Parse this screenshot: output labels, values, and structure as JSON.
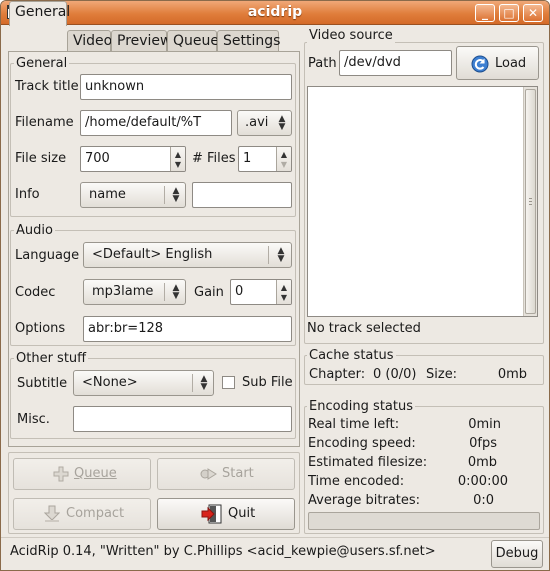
{
  "window": {
    "title": "acidrip",
    "controls": {
      "minimize": "_",
      "maximize": "□",
      "close": "✕"
    }
  },
  "tabs": [
    {
      "label": "General"
    },
    {
      "label": "Video"
    },
    {
      "label": "Preview"
    },
    {
      "label": "Queue"
    },
    {
      "label": "Settings"
    }
  ],
  "general": {
    "frame_label": "General",
    "track_title_label": "Track title",
    "track_title_value": "unknown",
    "filename_label": "Filename",
    "filename_value": "/home/default/%T",
    "extension_value": ".avi",
    "filesize_label": "File size",
    "filesize_value": "700",
    "files_label": "# Files",
    "files_value": "1",
    "info_label": "Info",
    "info_combo_value": "name",
    "info_entry_value": ""
  },
  "audio": {
    "frame_label": "Audio",
    "language_label": "Language",
    "language_value": "<Default> English",
    "codec_label": "Codec",
    "codec_value": "mp3lame",
    "gain_label": "Gain",
    "gain_value": "0",
    "options_label": "Options",
    "options_value": "abr:br=128"
  },
  "other": {
    "frame_label": "Other stuff",
    "subtitle_label": "Subtitle",
    "subtitle_value": "<None>",
    "subfile_label": "Sub File",
    "subfile_checked": false,
    "misc_label": "Misc.",
    "misc_value": ""
  },
  "actions": {
    "queue_label": "Queue",
    "start_label": "Start",
    "compact_label": "Compact",
    "quit_label": "Quit"
  },
  "video_source": {
    "frame_label": "Video source",
    "path_label": "Path",
    "path_value": "/dev/dvd",
    "load_label": "Load",
    "track_status": "No track selected"
  },
  "cache_status": {
    "frame_label": "Cache status",
    "chapter_label": "Chapter:",
    "chapter_value": "0 (0/0)",
    "size_label": "Size:",
    "size_value": "0mb"
  },
  "encoding_status": {
    "frame_label": "Encoding status",
    "rows": [
      {
        "label": "Real time left:",
        "value": "0min"
      },
      {
        "label": "Encoding speed:",
        "value": "0fps"
      },
      {
        "label": "Estimated filesize:",
        "value": "0mb"
      },
      {
        "label": "Time encoded:",
        "value": "0:00:00"
      },
      {
        "label": "Average bitrates:",
        "value": "0:0"
      }
    ],
    "progress": 0
  },
  "statusbar": {
    "text": "AcidRip 0.14, \"Written\" by C.Phillips <acid_kewpie@users.sf.net>",
    "debug_label": "Debug"
  }
}
